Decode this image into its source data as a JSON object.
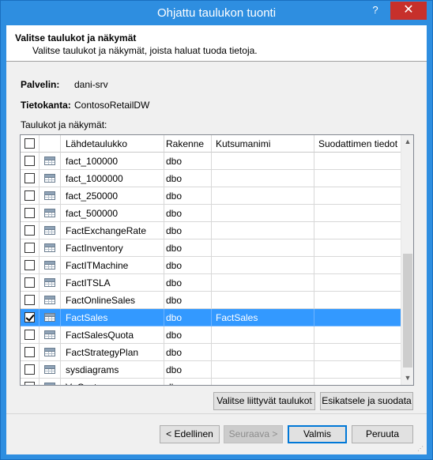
{
  "window": {
    "title": "Ohjattu taulukon tuonti",
    "help_label": "?",
    "close_label": "✕"
  },
  "header": {
    "title": "Valitse taulukot ja näkymät",
    "subtitle": "Valitse taulukot ja näkymät, joista haluat tuoda tietoja."
  },
  "info": {
    "server_label": "Palvelin:",
    "server_value": "dani-srv",
    "database_label": "Tietokanta:",
    "database_value": "ContosoRetailDW"
  },
  "grid": {
    "section_label": "Taulukot ja näkymät:",
    "columns": {
      "source": "Lähdetaulukko",
      "schema": "Rakenne",
      "friendly": "Kutsumanimi",
      "filter": "Suodattimen tiedot"
    },
    "rows": [
      {
        "source": "fact_100000",
        "schema": "dbo",
        "friendly": "",
        "filter": "",
        "checked": false
      },
      {
        "source": "fact_1000000",
        "schema": "dbo",
        "friendly": "",
        "filter": "",
        "checked": false
      },
      {
        "source": "fact_250000",
        "schema": "dbo",
        "friendly": "",
        "filter": "",
        "checked": false
      },
      {
        "source": "fact_500000",
        "schema": "dbo",
        "friendly": "",
        "filter": "",
        "checked": false
      },
      {
        "source": "FactExchangeRate",
        "schema": "dbo",
        "friendly": "",
        "filter": "",
        "checked": false
      },
      {
        "source": "FactInventory",
        "schema": "dbo",
        "friendly": "",
        "filter": "",
        "checked": false
      },
      {
        "source": "FactITMachine",
        "schema": "dbo",
        "friendly": "",
        "filter": "",
        "checked": false
      },
      {
        "source": "FactITSLA",
        "schema": "dbo",
        "friendly": "",
        "filter": "",
        "checked": false
      },
      {
        "source": "FactOnlineSales",
        "schema": "dbo",
        "friendly": "",
        "filter": "",
        "checked": false
      },
      {
        "source": "FactSales",
        "schema": "dbo",
        "friendly": "FactSales",
        "filter": "",
        "checked": true
      },
      {
        "source": "FactSalesQuota",
        "schema": "dbo",
        "friendly": "",
        "filter": "",
        "checked": false
      },
      {
        "source": "FactStrategyPlan",
        "schema": "dbo",
        "friendly": "",
        "filter": "",
        "checked": false
      },
      {
        "source": "sysdiagrams",
        "schema": "dbo",
        "friendly": "",
        "filter": "",
        "checked": false
      },
      {
        "source": "V_Customer",
        "schema": "dbo",
        "friendly": "",
        "filter": "",
        "checked": false
      }
    ],
    "selected_index": 9,
    "scroll_up": "▲",
    "scroll_down": "▼"
  },
  "buttons": {
    "select_related": "Valitse liittyvät taulukot",
    "preview_filter": "Esikatsele ja suodata",
    "back": "< Edellinen",
    "next": "Seuraava >",
    "finish": "Valmis",
    "cancel": "Peruuta"
  }
}
